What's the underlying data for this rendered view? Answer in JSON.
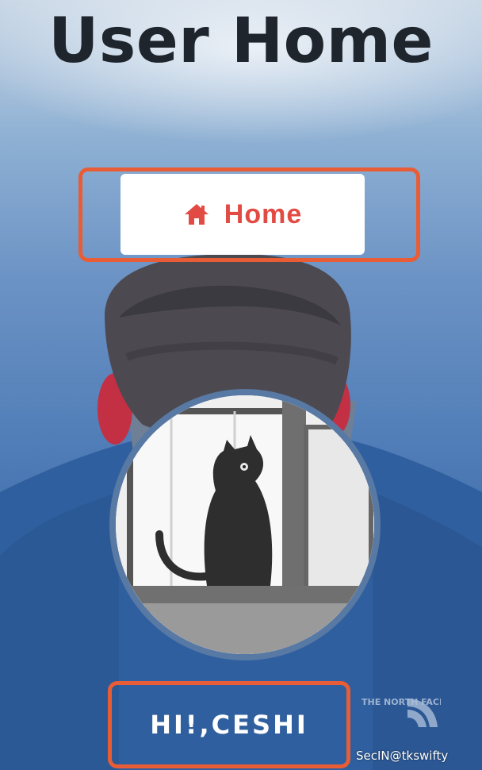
{
  "page": {
    "title": "User Home"
  },
  "nav": {
    "home_label": "Home",
    "home_icon": "home-icon"
  },
  "profile": {
    "greeting": "HI!,CESHI",
    "avatar": "cat-avatar"
  },
  "background": {
    "brand_logo": "THE NORTH FACE"
  },
  "watermark": {
    "text": "SecIN@tkswifty"
  },
  "colors": {
    "highlight": "#e85d36",
    "home_accent": "#e24b43",
    "title": "#1f252d",
    "avatar_border": "#5779a4",
    "background_blue": "#507db7"
  }
}
